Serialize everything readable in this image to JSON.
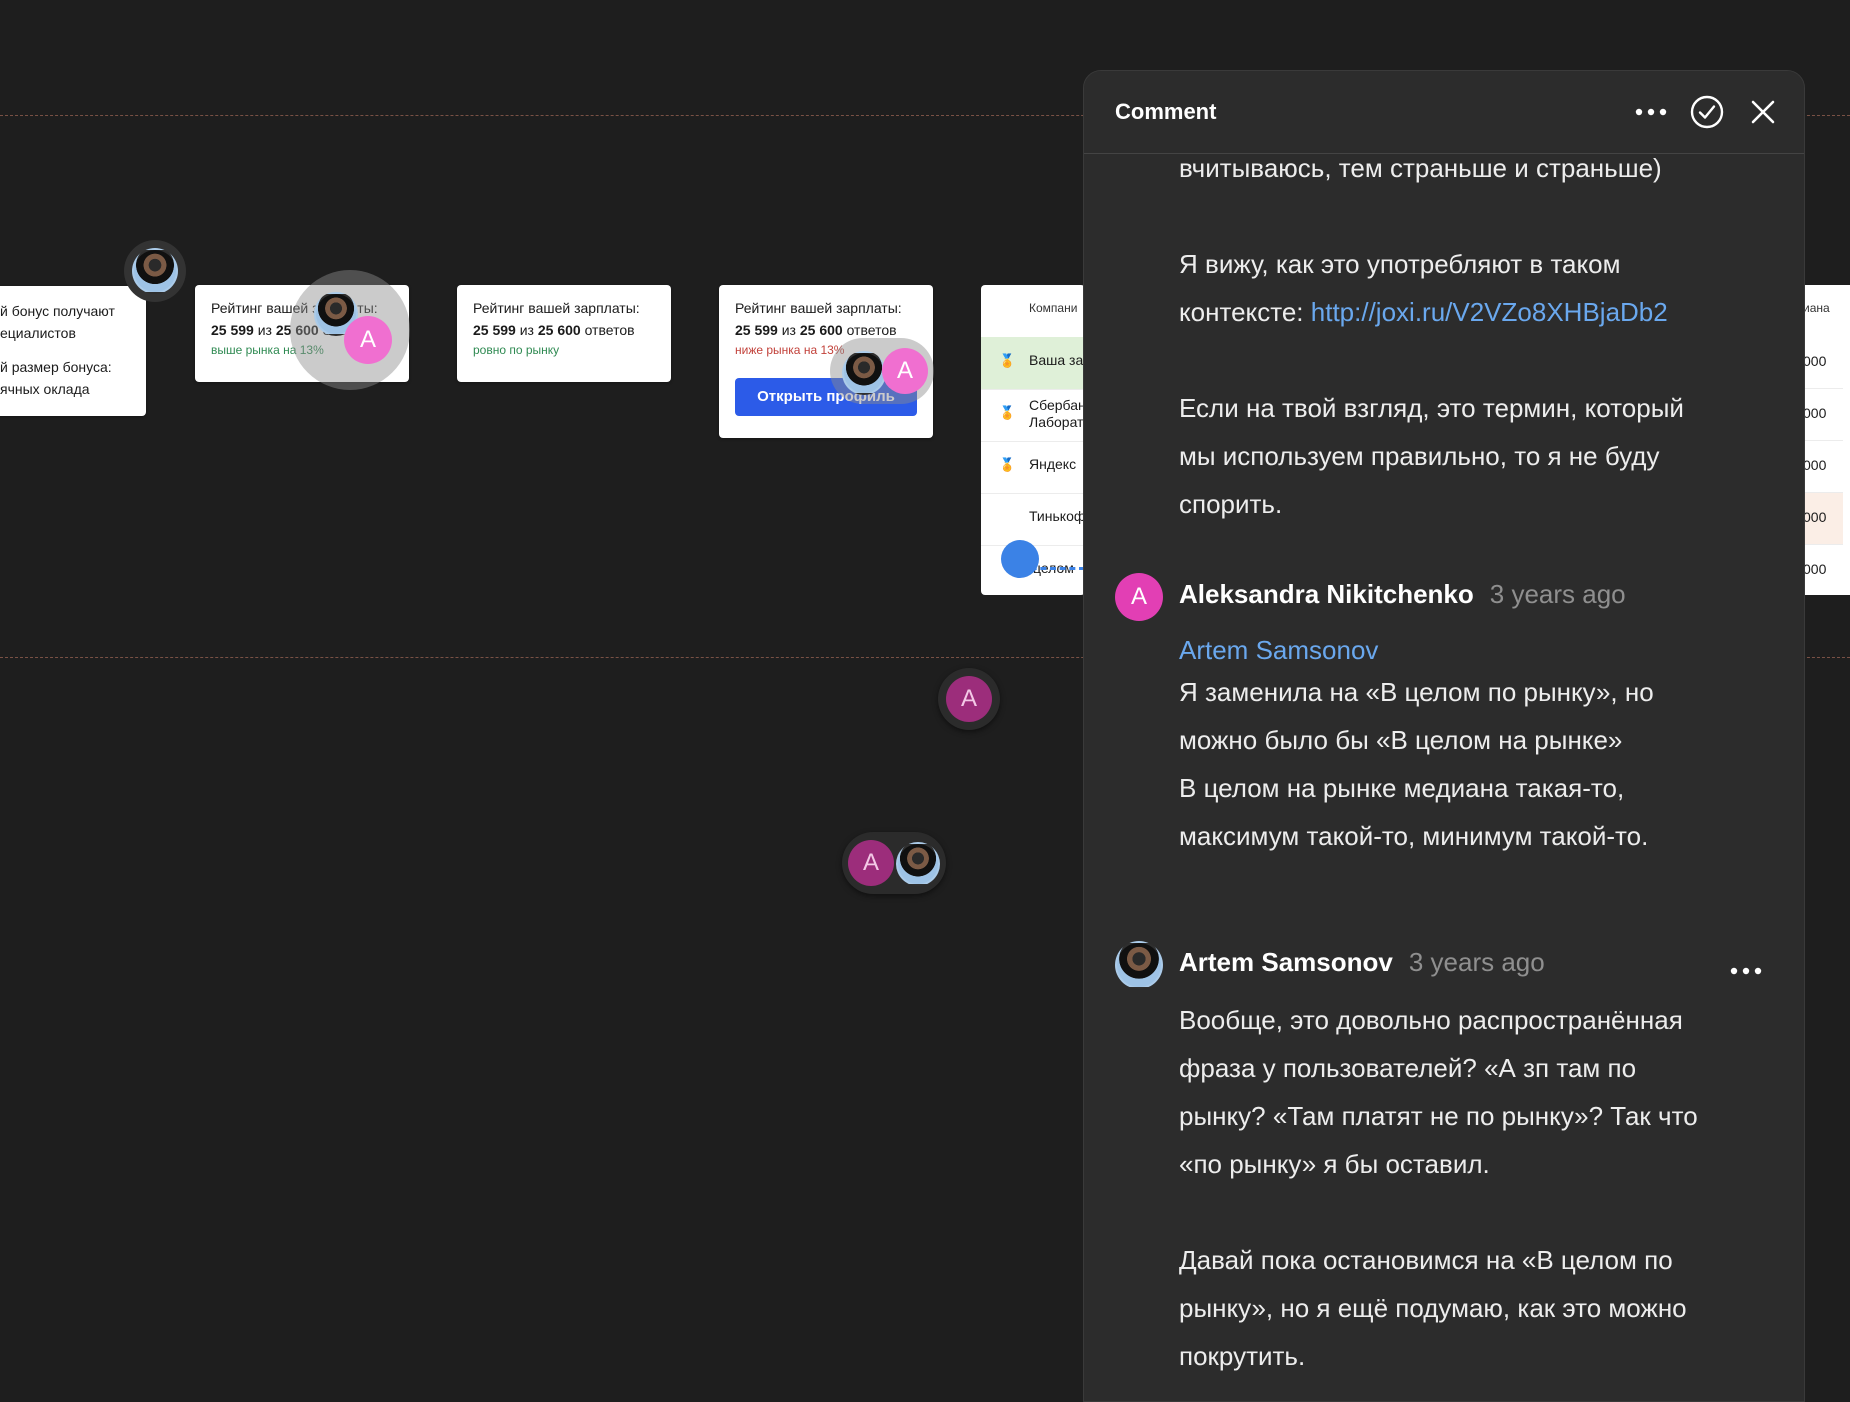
{
  "canvas": {
    "card_bonus": {
      "line1": "й бонус получают",
      "line2": "ециалистов",
      "line3": "й размер бонуса:",
      "line4": "ячных оклада"
    },
    "card1": {
      "heading": "Рейтинг вашей зарплаты:",
      "rank": "25 599",
      "of": "из",
      "total": "25 600",
      "answers": "ответов",
      "status": "выше рынка на 13%"
    },
    "card2": {
      "heading": "Рейтинг вашей зарплаты:",
      "rank": "25 599",
      "of": "из",
      "total": "25 600",
      "answers": "ответов",
      "status": "ровно по рынку"
    },
    "card3": {
      "heading": "Рейтинг вашей зарплаты:",
      "rank": "25 599",
      "of": "из",
      "total": "25 600",
      "answers": "ответов",
      "status": "ниже рынка на 13%",
      "button": "Открыть профиль"
    },
    "table": {
      "header": "Компани",
      "rows": [
        "Ваша за",
        "Сбербан\nЛаборат",
        "Яндекс",
        "Тинькоф",
        "целом"
      ],
      "right_header": "иана",
      "right_values": [
        "000",
        "000",
        "000",
        "000",
        "000"
      ]
    },
    "pins": {
      "letter": "A"
    }
  },
  "comment_panel": {
    "title": "Comment",
    "icons": [
      "more-icon",
      "check-circle-icon",
      "close-icon"
    ],
    "thread": {
      "intro_lines": [
        "вчитываюсь, тем страньше и страньше)"
      ],
      "para2_lines": [
        "Я вижу, как это употребляют в таком"
      ],
      "para2_prefix": "контексте:",
      "para2_link": "http://joxi.ru/V2VZo8XHBjaDb2",
      "para3_lines": [
        "Если на твой взгляд, это термин, который",
        "мы используем правильно, то я не буду",
        "спорить."
      ]
    },
    "comment2": {
      "avatar_letter": "A",
      "author": "Aleksandra Nikitchenko",
      "time": "3 years ago",
      "mention": "Artem Samsonov",
      "lines1": [
        "Я заменила на «В целом по рынку», но",
        "можно было бы «В целом на рынке»"
      ],
      "lines2": [
        "В целом на рынке медиана такая-то,",
        "максимум такой-то, минимум такой-то."
      ]
    },
    "comment3": {
      "author": "Artem Samsonov",
      "time": "3 years ago",
      "lines1": [
        "Вообще, это довольно распространённая",
        "фраза у пользователей? «А зп там по",
        "рынку? «Там платят не по рынку»? Так что",
        "«по рынку» я бы оставил."
      ],
      "lines2": [
        "Давай пока остановимся на «В целом по",
        "рынку», но я ещё подумаю, как это можно",
        "покрутить."
      ]
    }
  },
  "colors": {
    "background": "#1e1e1e",
    "panel": "#2c2c2c",
    "link": "#6aa8ee",
    "avatar_pink": "#e23fb4",
    "cta_blue": "#2c5be8"
  }
}
